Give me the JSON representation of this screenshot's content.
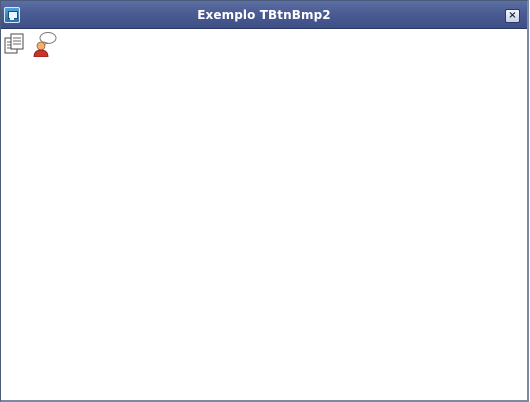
{
  "window": {
    "title": "Exemplo TBtnBmp2",
    "app_icon": "monitor-icon",
    "close_label": "×",
    "close_icon": "close-icon"
  },
  "toolbar": {
    "buttons": [
      {
        "icon": "documents-icon"
      },
      {
        "icon": "user-chat-icon"
      }
    ]
  },
  "colors": {
    "titlebar": "#4a5c92",
    "client_background": "#ffffff"
  }
}
